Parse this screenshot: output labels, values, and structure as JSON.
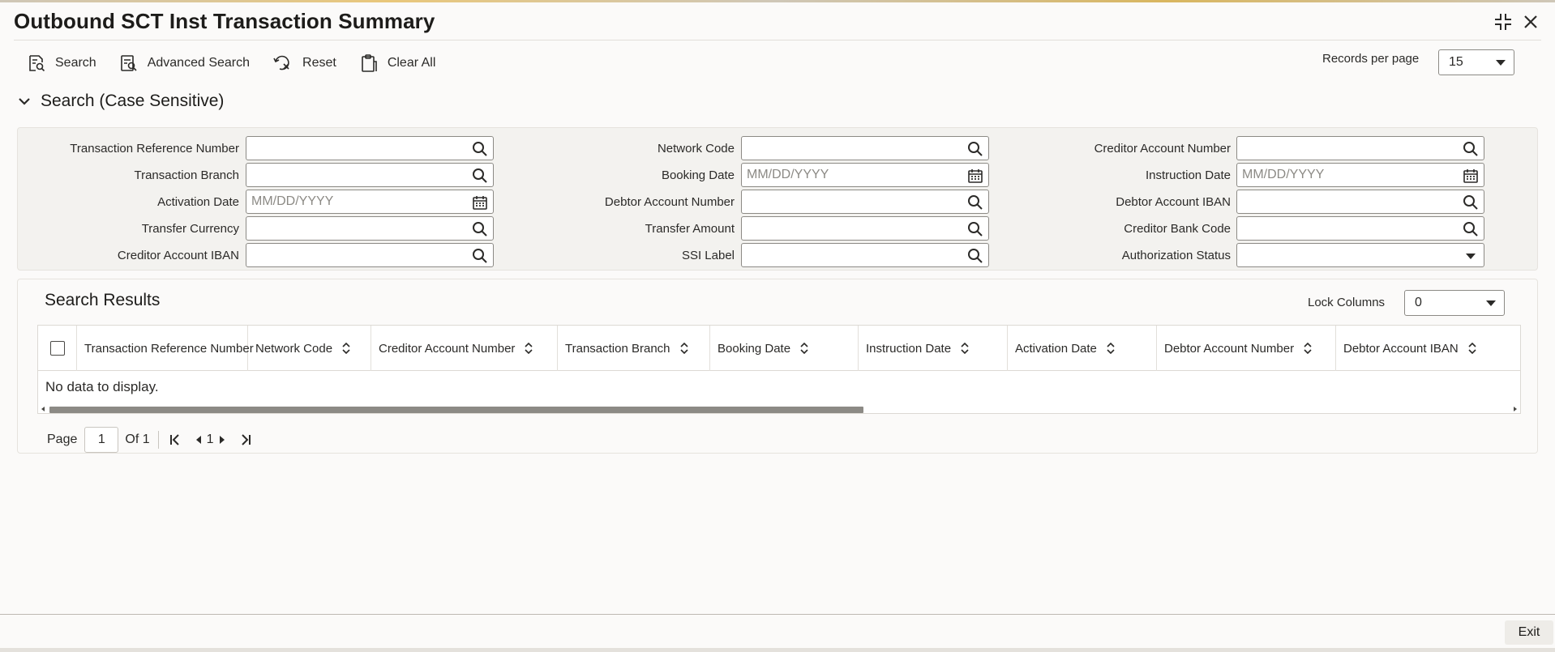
{
  "window": {
    "title": "Outbound SCT Inst Transaction Summary",
    "controls": {
      "maximize_icon": "maximize-icon",
      "close_icon": "close-icon"
    }
  },
  "toolbar": {
    "search_label": "Search",
    "advanced_search_label": "Advanced Search",
    "reset_label": "Reset",
    "clear_all_label": "Clear All",
    "records_per_page_label": "Records per page",
    "records_per_page_value": "15"
  },
  "search_section": {
    "title": "Search (Case Sensitive)",
    "fields": {
      "transaction_reference_number": {
        "label": "Transaction Reference Number",
        "value": "",
        "icon": "search-icon"
      },
      "transaction_branch": {
        "label": "Transaction Branch",
        "value": "",
        "icon": "search-icon"
      },
      "activation_date": {
        "label": "Activation Date",
        "placeholder": "MM/DD/YYYY",
        "icon": "calendar-icon"
      },
      "transfer_currency": {
        "label": "Transfer Currency",
        "value": "",
        "icon": "search-icon"
      },
      "creditor_account_iban": {
        "label": "Creditor Account IBAN",
        "value": "",
        "icon": "search-icon"
      },
      "network_code": {
        "label": "Network Code",
        "value": "",
        "icon": "search-icon"
      },
      "booking_date": {
        "label": "Booking Date",
        "placeholder": "MM/DD/YYYY",
        "icon": "calendar-icon"
      },
      "debtor_account_number": {
        "label": "Debtor Account Number",
        "value": "",
        "icon": "search-icon"
      },
      "transfer_amount": {
        "label": "Transfer Amount",
        "value": "",
        "icon": "search-icon"
      },
      "ssi_label": {
        "label": "SSI Label",
        "value": "",
        "icon": "search-icon"
      },
      "creditor_account_number": {
        "label": "Creditor Account Number",
        "value": "",
        "icon": "search-icon"
      },
      "instruction_date": {
        "label": "Instruction Date",
        "placeholder": "MM/DD/YYYY",
        "icon": "calendar-icon"
      },
      "debtor_account_iban": {
        "label": "Debtor Account IBAN",
        "value": "",
        "icon": "search-icon"
      },
      "creditor_bank_code": {
        "label": "Creditor Bank Code",
        "value": "",
        "icon": "search-icon"
      },
      "authorization_status": {
        "label": "Authorization Status",
        "value": "",
        "icon": "chevron-down-icon"
      }
    }
  },
  "results": {
    "title": "Search Results",
    "lock_columns_label": "Lock Columns",
    "lock_columns_value": "0",
    "columns": [
      "Transaction Reference Number",
      "Network Code",
      "Creditor Account Number",
      "Transaction Branch",
      "Booking Date",
      "Instruction Date",
      "Activation Date",
      "Debtor Account Number",
      "Debtor Account IBAN"
    ],
    "rows": [],
    "empty_message": "No data to display."
  },
  "pagination": {
    "page_label": "Page",
    "page_value": "1",
    "of_label": "Of 1",
    "current_page": "1"
  },
  "footer": {
    "exit_label": "Exit"
  },
  "colors": {
    "background": "#fbfaf9",
    "panel": "#f3f2ef",
    "text": "#161513",
    "border": "#8c8a85"
  }
}
